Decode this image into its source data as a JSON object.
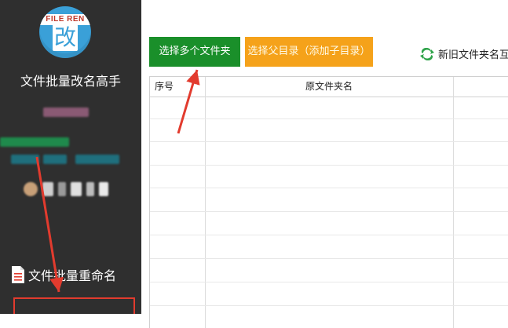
{
  "sidebar": {
    "logo_text": "FILE REN",
    "logo_glyph": "改",
    "app_title": "文件批量改名高手",
    "menu_item": "文件批量重命名",
    "menu_icon": "document-icon"
  },
  "toolbar": {
    "select_folders_label": "选择多个文件夹",
    "select_parent_label": "选择父目录（添加子目录）",
    "swap_label": "新旧文件夹名互换",
    "swap_icon": "swap-arrows-icon"
  },
  "table": {
    "columns": [
      "序号",
      "原文件夹名"
    ],
    "rows": []
  },
  "colors": {
    "sidebar_bg": "#2f2f2f",
    "green_button": "#1a8f2a",
    "orange_button": "#f5a21a",
    "annotation_red": "#e23b2e"
  }
}
